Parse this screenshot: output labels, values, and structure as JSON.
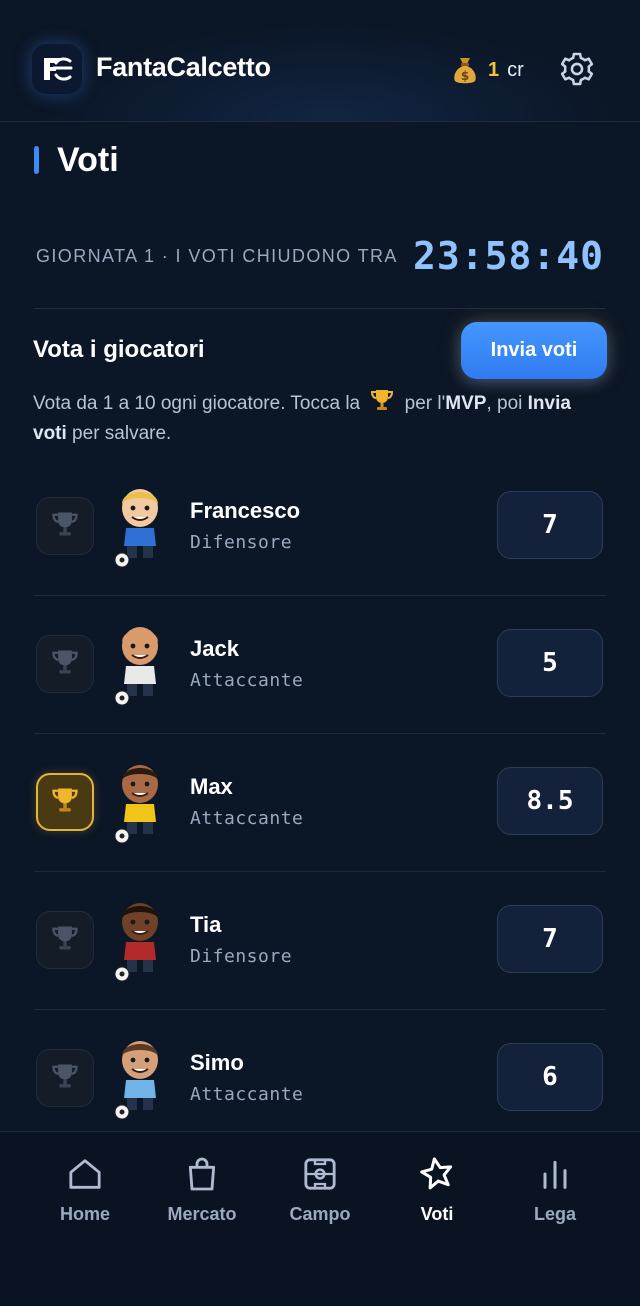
{
  "header": {
    "app_name": "FantaCalcetto",
    "credits_amount": "1",
    "credits_unit": "cr",
    "logo_text": "FC"
  },
  "page": {
    "title": "Voti"
  },
  "round": {
    "label": "GIORNATA 1 · I VOTI CHIUDONO TRA",
    "countdown": "23:58:40"
  },
  "vote_section": {
    "title": "Vota i giocatori",
    "send_label": "Invia voti",
    "instr_part1": "Vota da 1 a 10 ogni giocatore. Tocca la ",
    "instr_part2": " per l'",
    "instr_mvp": "MVP",
    "instr_part3": ", poi ",
    "instr_send": "Invia voti",
    "instr_part4": " per salvare."
  },
  "players": [
    {
      "name": "Francesco",
      "role": "Difensore",
      "vote": "7",
      "mvp": false,
      "skin": "#f2c9a0",
      "hair": "#e8c04a",
      "shirt": "#2f6fd6"
    },
    {
      "name": "Jack",
      "role": "Attaccante",
      "vote": "5",
      "mvp": false,
      "skin": "#d99a6c",
      "hair": "#d99a6c",
      "shirt": "#e9e9e9"
    },
    {
      "name": "Max",
      "role": "Attaccante",
      "vote": "8.5",
      "mvp": true,
      "skin": "#a86a45",
      "hair": "#2a1a10",
      "shirt": "#f0c419"
    },
    {
      "name": "Tia",
      "role": "Difensore",
      "vote": "7",
      "mvp": false,
      "skin": "#6e4128",
      "hair": "#1e130b",
      "shirt": "#b32a2a"
    },
    {
      "name": "Simo",
      "role": "Attaccante",
      "vote": "6",
      "mvp": false,
      "skin": "#d4a07a",
      "hair": "#5a3a20",
      "shirt": "#6fb3e8"
    }
  ],
  "nav": [
    {
      "label": "Home",
      "icon": "home-icon",
      "active": false
    },
    {
      "label": "Mercato",
      "icon": "bag-icon",
      "active": false
    },
    {
      "label": "Campo",
      "icon": "pitch-icon",
      "active": false
    },
    {
      "label": "Voti",
      "icon": "star-icon",
      "active": true
    },
    {
      "label": "Lega",
      "icon": "bar-chart-icon",
      "active": false
    }
  ],
  "colors": {
    "background": "#0b1626",
    "accent": "#3b8df5",
    "gold": "#f5c33b",
    "countdown": "#8fc2ff"
  }
}
